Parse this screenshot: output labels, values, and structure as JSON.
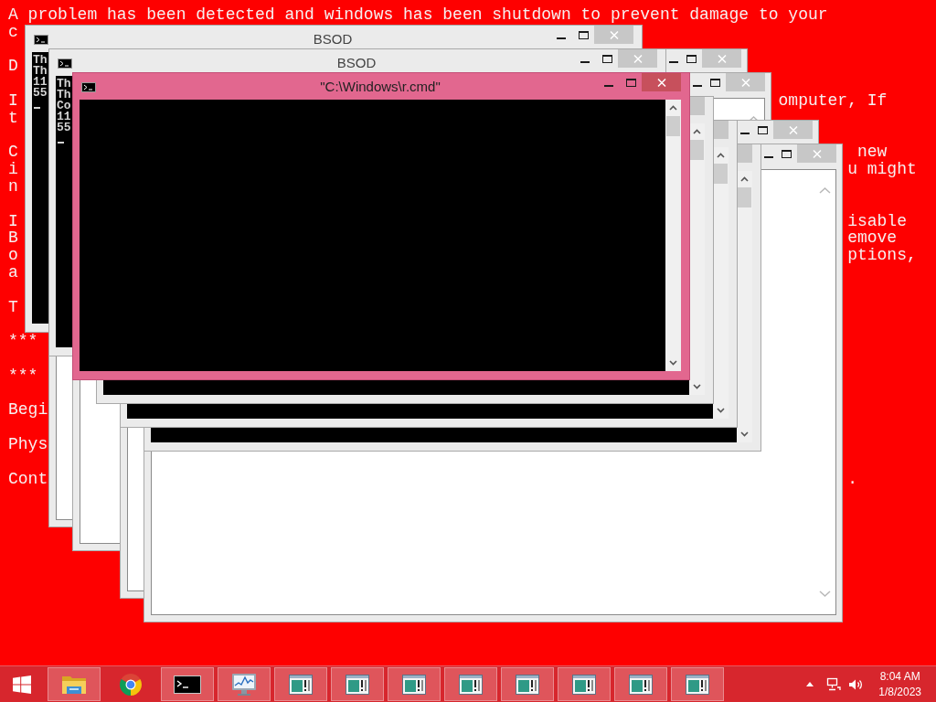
{
  "desktop_text": [
    {
      "lines": [
        {
          "left": "A problem has been detected and windows has been shutdown to prevent damage to your"
        },
        {
          "left": "c"
        }
      ]
    },
    {
      "lines": [
        {
          "left": "D"
        }
      ]
    },
    {
      "lines": [
        {
          "left": "I",
          "right": "omputer, If"
        },
        {
          "left": "t"
        }
      ]
    },
    {
      "lines": [
        {
          "left": "C",
          "right": "new"
        },
        {
          "left": "i",
          "right": "u might"
        },
        {
          "left": "n"
        }
      ]
    },
    {
      "lines": [
        {
          "left": "I",
          "right": "isable"
        },
        {
          "left": "B",
          "right": "emove"
        },
        {
          "left": "o",
          "right": "ptions,"
        },
        {
          "left": "a"
        }
      ]
    },
    {
      "lines": [
        {
          "left": "T"
        }
      ]
    },
    {
      "lines": [
        {
          "left": "***"
        }
      ]
    },
    {
      "lines": [
        {
          "left": "***"
        }
      ]
    },
    {
      "lines": [
        {
          "left": "Begi"
        }
      ]
    },
    {
      "lines": [
        {
          "left": "Phys"
        }
      ]
    },
    {
      "lines": [
        {
          "left": "Cont",
          "right": "."
        }
      ]
    }
  ],
  "windows": [
    {
      "kind": "text",
      "active": false
    },
    {
      "kind": "text",
      "active": false
    },
    {
      "kind": "text",
      "active": false
    },
    {
      "kind": "text",
      "active": false
    },
    {
      "kind": "console",
      "active": false
    },
    {
      "kind": "console",
      "active": false
    },
    {
      "kind": "console",
      "active": false
    },
    {
      "kind": "console",
      "active": false,
      "title": "BSOD",
      "lines": [
        "Th",
        "Th",
        "11",
        "55"
      ]
    },
    {
      "kind": "console",
      "active": false,
      "title": "BSOD",
      "lines": [
        "Th",
        "Th",
        "Co",
        "11",
        "55"
      ]
    },
    {
      "kind": "console",
      "active": true,
      "title": "\"C:\\Windows\\r.cmd\""
    }
  ],
  "taskbar": {
    "apps": [
      {
        "kind": "folder",
        "running": true
      },
      {
        "kind": "browser",
        "running": false
      },
      {
        "kind": "console",
        "running": true
      },
      {
        "kind": "monitor",
        "running": true
      },
      {
        "kind": "window",
        "running": true
      },
      {
        "kind": "window",
        "running": true
      },
      {
        "kind": "window",
        "running": true
      },
      {
        "kind": "window",
        "running": true
      },
      {
        "kind": "window",
        "running": true
      },
      {
        "kind": "window",
        "running": true
      },
      {
        "kind": "window",
        "running": true
      },
      {
        "kind": "window",
        "running": true
      }
    ],
    "clock": {
      "time": "8:04 AM",
      "date": "1/8/2023"
    }
  }
}
